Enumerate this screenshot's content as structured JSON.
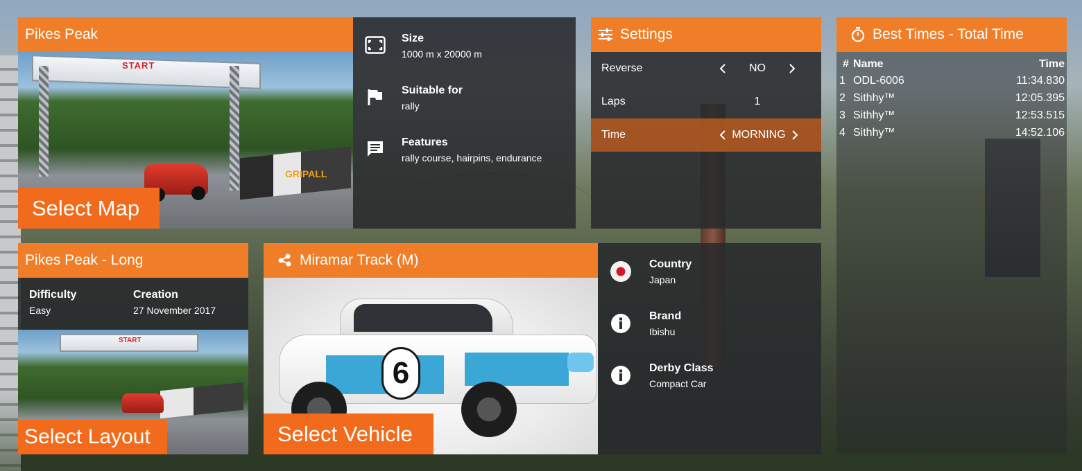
{
  "colors": {
    "accent": "#f07e29",
    "button": "#f26b1d",
    "panel": "#2a2c2e",
    "active_row": "#b65a1e"
  },
  "map": {
    "title": "Pikes Peak",
    "select_label": "Select Map",
    "preview": {
      "banner_text": "START",
      "barrier_text": "GRIPALL"
    },
    "info": [
      {
        "icon": "size-icon",
        "label": "Size",
        "value": "1000 m x 20000 m"
      },
      {
        "icon": "flag-icon",
        "label": "Suitable for",
        "value": "rally"
      },
      {
        "icon": "comment-icon",
        "label": "Features",
        "value": "rally course, hairpins, endurance"
      }
    ]
  },
  "settings": {
    "title": "Settings",
    "rows": [
      {
        "label": "Reverse",
        "value": "NO",
        "has_arrows": true,
        "active": false
      },
      {
        "label": "Laps",
        "value": "1",
        "has_arrows": false,
        "active": false
      },
      {
        "label": "Time",
        "value": "MORNING",
        "has_arrows": true,
        "active": true
      }
    ]
  },
  "best_times": {
    "title": "Best Times - Total Time",
    "columns": [
      "#",
      "Name",
      "Time"
    ],
    "rows": [
      {
        "rank": "1",
        "name": "ODL-6006",
        "time": "11:34.830"
      },
      {
        "rank": "2",
        "name": "Sithhy™",
        "time": "12:05.395"
      },
      {
        "rank": "3",
        "name": "Sithhy™",
        "time": "12:53.515"
      },
      {
        "rank": "4",
        "name": "Sithhy™",
        "time": "14:52.106"
      }
    ]
  },
  "layout": {
    "title": "Pikes Peak - Long",
    "difficulty_label": "Difficulty",
    "difficulty_value": "Easy",
    "creation_label": "Creation",
    "creation_value": "27 November 2017",
    "select_label": "Select Layout",
    "preview": {
      "banner_text": "START"
    }
  },
  "vehicle": {
    "title": "Miramar Track (M)",
    "select_label": "Select Vehicle",
    "number": "6",
    "info": [
      {
        "icon": "japan-flag-icon",
        "label": "Country",
        "value": "Japan"
      },
      {
        "icon": "info-icon",
        "label": "Brand",
        "value": "Ibishu"
      },
      {
        "icon": "info-icon",
        "label": "Derby Class",
        "value": "Compact Car"
      }
    ]
  }
}
